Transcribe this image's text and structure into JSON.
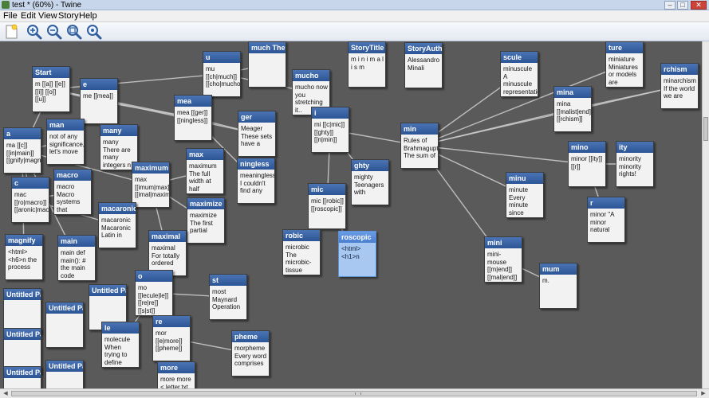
{
  "window": {
    "title": "test * (60%) - Twine"
  },
  "menu": {
    "file": "File",
    "edit": "Edit",
    "view": "View",
    "story": "Story",
    "help": "Help"
  },
  "toolbar": {
    "new_passage_icon": "new-passage-icon",
    "zoom_in_icon": "zoom-in-icon",
    "zoom_out_icon": "zoom-out-icon",
    "zoom_fit_icon": "zoom-fit-icon",
    "zoom_reset_icon": "zoom-reset-icon"
  },
  "colors": {
    "canvas": "#5a5a5a",
    "title_bar": "#2c5597",
    "link_line": "#cfcfcf",
    "selected": "#a8c8f2"
  },
  "passages": [
    {
      "title": "Start",
      "excerpt": "m [[a]] [[e]] [[i]] [[o]] [[u]]",
      "links": [
        "a",
        "e",
        "mea",
        "ger",
        "u"
      ]
    },
    {
      "title": "e",
      "excerpt": "me [[mea]]",
      "links": [
        "mea"
      ]
    },
    {
      "title": "u",
      "excerpt": "mu [[ch|much]] [[cho|mucho]]",
      "links": [
        "much The popularity of MuchMusic",
        "mucho"
      ]
    },
    {
      "title": "much The popularity of MuchMusic",
      "excerpt": "",
      "links": []
    },
    {
      "title": "mucho",
      "excerpt": "mucho now you stretching it..",
      "links": []
    },
    {
      "title": "StoryTitle",
      "excerpt": "m i n i m a l i s m",
      "links": []
    },
    {
      "title": "StoryAuthor",
      "excerpt": "Alessandro Minali",
      "links": []
    },
    {
      "title": "scule",
      "excerpt": "minuscule A minuscule representation",
      "links": []
    },
    {
      "title": "ture",
      "excerpt": "miniature Miniatures or models are",
      "links": []
    },
    {
      "title": "rchism",
      "excerpt": "minarchism If the world we are",
      "links": []
    },
    {
      "title": "a",
      "excerpt": "ma [[c]] [[in|main]] [[gnify|magnify]]",
      "links": [
        "c",
        "main",
        "magnify",
        "man",
        "maximum"
      ]
    },
    {
      "title": "man",
      "excerpt": "not of any significance, let's move",
      "links": []
    },
    {
      "title": "many",
      "excerpt": "many There are many integers n <",
      "links": []
    },
    {
      "title": "mea",
      "excerpt": "mea [[ger]] [[ningless]]",
      "links": [
        "ger",
        "ningless"
      ]
    },
    {
      "title": "ger",
      "excerpt": "Meager These sets have a",
      "links": []
    },
    {
      "title": "i",
      "excerpt": "mi [[c|mic]] [[ghty]] [[n|min]]",
      "links": [
        "mic",
        "ghty",
        "min"
      ]
    },
    {
      "title": "min",
      "excerpt": "Rules of Brahmagupta The sum of",
      "links": [
        "scule",
        "ture",
        "rchism",
        "mina",
        "mino",
        "minu",
        "mini"
      ]
    },
    {
      "title": "mina",
      "excerpt": "mina [[malist|end]] [[rchism]]",
      "links": [
        "rchism"
      ]
    },
    {
      "title": "c",
      "excerpt": "mac [[ro|macro]] [[aronic|macaronic]]",
      "links": [
        "macro",
        "macaronic"
      ]
    },
    {
      "title": "macro",
      "excerpt": "macro Macro systems that",
      "links": []
    },
    {
      "title": "maximum",
      "excerpt": "max [[imum|max]] [[imal|maximal]]",
      "links": [
        "max",
        "maximal",
        "maximize"
      ]
    },
    {
      "title": "max",
      "excerpt": "maximum The full width at half",
      "links": []
    },
    {
      "title": "ningless",
      "excerpt": "meaningless I couldn't find any",
      "links": []
    },
    {
      "title": "ghty",
      "excerpt": "mighty Teenagers with",
      "links": []
    },
    {
      "title": "mino",
      "excerpt": "minor [[ity]] [[r]]",
      "links": [
        "ity",
        "r"
      ]
    },
    {
      "title": "ity",
      "excerpt": "minority minority rights!",
      "links": []
    },
    {
      "title": "minu",
      "excerpt": "minute Every minute since",
      "links": []
    },
    {
      "title": "mic",
      "excerpt": "mic [[robic]] [[roscopic]]",
      "links": [
        "robic",
        "roscopic"
      ]
    },
    {
      "title": "maximize",
      "excerpt": "maximize The first partial",
      "links": []
    },
    {
      "title": "macaronic",
      "excerpt": "macaronic Macaronic Latin in",
      "links": []
    },
    {
      "title": "r",
      "excerpt": "minor \"A minor natural",
      "links": []
    },
    {
      "title": "magnify",
      "excerpt": "<html><h6>n the process",
      "links": []
    },
    {
      "title": "main",
      "excerpt": "main def main(): # the main code",
      "links": []
    },
    {
      "title": "maximal",
      "excerpt": "maximal For totally ordered",
      "links": []
    },
    {
      "title": "robic",
      "excerpt": "microbic The microbic-tissue affinity of an",
      "links": []
    },
    {
      "title": "roscopic",
      "excerpt": "<html><h1>n",
      "links": [],
      "selected": true
    },
    {
      "title": "mini",
      "excerpt": "mini-mouse [[m|end]] [[mal|end]]",
      "links": [
        "mum"
      ]
    },
    {
      "title": "mum",
      "excerpt": "m.",
      "links": []
    },
    {
      "title": "o",
      "excerpt": "mo [[lecule|le]] [[re|re]] [[s|st]]",
      "links": [
        "le",
        "re",
        "st"
      ]
    },
    {
      "title": "st",
      "excerpt": "most Maynard Operation",
      "links": []
    },
    {
      "title": "Untitled Passage",
      "excerpt": "",
      "links": []
    },
    {
      "title": "Untitled Passage",
      "excerpt": "",
      "links": []
    },
    {
      "title": "Untitled Passage",
      "excerpt": "",
      "links": []
    },
    {
      "title": "Untitled Passage",
      "excerpt": "",
      "links": []
    },
    {
      "title": "Untitled Passage",
      "excerpt": "",
      "links": []
    },
    {
      "title": "Untitled Passage",
      "excerpt": "",
      "links": []
    },
    {
      "title": "le",
      "excerpt": "molecule When trying to define",
      "links": []
    },
    {
      "title": "re",
      "excerpt": "mor [[e|more]] [[pheme]]",
      "links": [
        "more",
        "pheme"
      ]
    },
    {
      "title": "pheme",
      "excerpt": "morpheme Every word comprises",
      "links": []
    },
    {
      "title": "more",
      "excerpt": "more more < letter.txt type",
      "links": []
    }
  ]
}
